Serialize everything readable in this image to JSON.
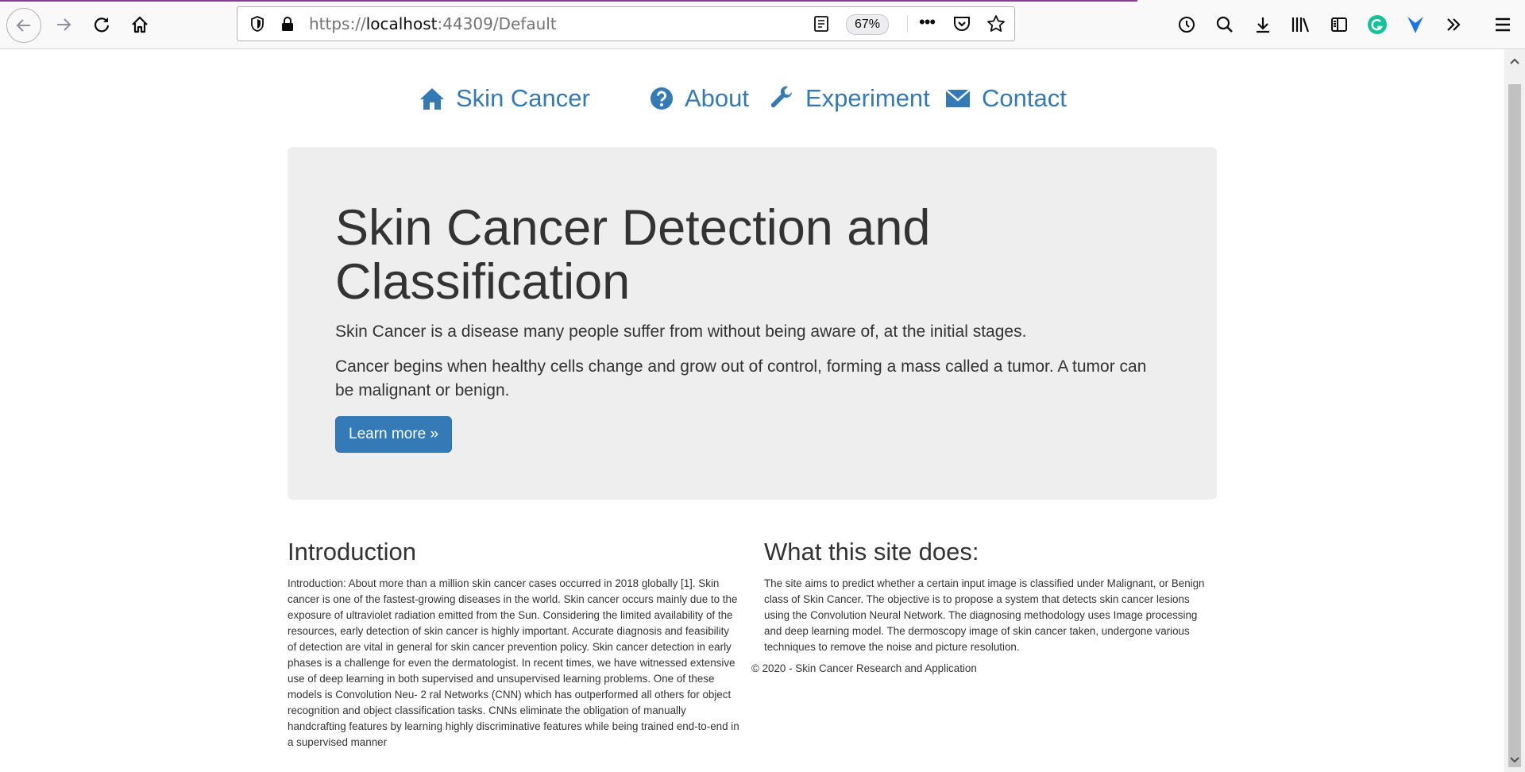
{
  "browser": {
    "url_scheme": "https://",
    "url_host": "localhost",
    "url_rest": ":44309/Default",
    "zoom": "67%",
    "more_label": "•••"
  },
  "nav": {
    "brand": "Skin Cancer",
    "about": "About",
    "experiment": "Experiment",
    "contact": "Contact",
    "link_color": "#337ab7"
  },
  "jumbotron": {
    "title": "Skin Cancer Detection and Classification",
    "lead1": "Skin Cancer is a disease many people suffer from without being aware of, at the initial stages.",
    "lead2": "Cancer begins when healthy cells change and grow out of control, forming a mass called a tumor. A tumor can be malignant or benign.",
    "button": "Learn more »"
  },
  "intro": {
    "heading": "Introduction",
    "body": "Introduction: About more than a million skin cancer cases occurred in 2018 globally [1]. Skin cancer is one of the fastest-growing diseases in the world. Skin cancer occurs mainly due to the exposure of ultraviolet radiation emitted from the Sun. Considering the limited availability of the resources, early detection of skin cancer is highly important. Accurate diagnosis and feasibility of detection are vital in general for skin cancer prevention policy. Skin cancer detection in early phases is a challenge for even the dermatologist. In recent times, we have witnessed extensive use of deep learning in both supervised and unsupervised learning problems. One of these models is Convolution Neu- 2 ral Networks (CNN) which has outperformed all others for object recognition and object classification tasks. CNNs eliminate the obligation of manually handcrafting features by learning highly discriminative features while being trained end-to-end in a supervised manner"
  },
  "site": {
    "heading": "What this site does:",
    "body": "The site aims to predict whether a certain input image is classified under Malignant, or Benign class of Skin Cancer. The objective is to propose a system that detects skin cancer lesions using the Convolution Neural Network. The diagnosing methodology uses Image processing and deep learning model. The dermoscopy image of skin cancer taken, undergone various techniques to remove the noise and picture resolution."
  },
  "footer": {
    "text": "© 2020 - Skin Cancer Research and Application"
  },
  "icons": [
    "back-icon",
    "forward-icon",
    "reload-icon",
    "home-icon",
    "shield-icon",
    "lock-icon",
    "reader-view-icon",
    "pocket-icon",
    "star-icon",
    "history-icon",
    "search-icon",
    "download-icon",
    "library-icon",
    "sidebar-icon",
    "grammarly-icon",
    "extension-icon",
    "overflow-icon",
    "menu-icon",
    "question-circle-icon",
    "wrench-icon",
    "envelope-icon"
  ]
}
